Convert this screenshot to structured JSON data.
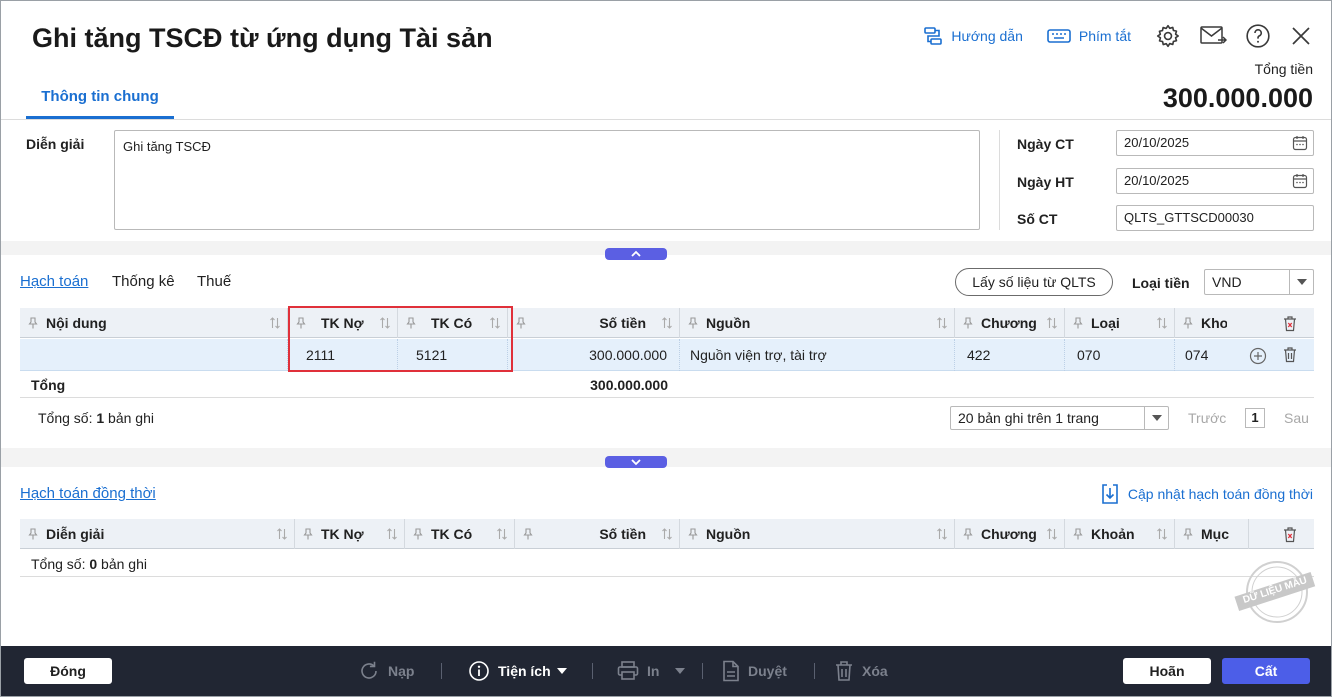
{
  "header": {
    "title": "Ghi tăng TSCĐ từ ứng dụng Tài sản",
    "guide_label": "Hướng dẫn",
    "shortcut_label": "Phím tắt",
    "total_label": "Tổng tiền",
    "total_value": "300.000.000",
    "tab_general": "Thông tin chung"
  },
  "form": {
    "desc_label": "Diễn giải",
    "desc_value": "Ghi tăng TSCĐ",
    "date_ct_label": "Ngày CT",
    "date_ct_value": "20/10/2025",
    "date_ht_label": "Ngày HT",
    "date_ht_value": "20/10/2025",
    "so_ct_label": "Số CT",
    "so_ct_value": "QLTS_GTTSCD00030"
  },
  "accounting": {
    "tabs": [
      "Hạch toán",
      "Thống kê",
      "Thuế"
    ],
    "fetch_button": "Lấy số liệu từ QLTS",
    "currency_label": "Loại tiền",
    "currency_value": "VND",
    "columns": [
      "Nội dung",
      "TK Nợ",
      "TK Có",
      "Số tiền",
      "Nguồn",
      "Chương",
      "Loại",
      "Kho"
    ],
    "row": {
      "noi_dung": "",
      "tk_no": "2111",
      "tk_co": "5121",
      "so_tien": "300.000.000",
      "nguon": "Nguồn viện trợ, tài trợ",
      "chuong": "422",
      "loai": "070",
      "kho": "074"
    },
    "sum_label": "Tổng",
    "sum_value": "300.000.000",
    "count_prefix": "Tổng số: ",
    "count_value": "1",
    "count_suffix": " bản ghi",
    "page_size": "20 bản ghi trên 1 trang",
    "prev": "Trước",
    "page": "1",
    "next": "Sau"
  },
  "concurrent": {
    "title": "Hạch toán đồng thời",
    "update_link": "Cập nhật hạch toán đồng thời",
    "columns": [
      "Diễn giải",
      "TK Nợ",
      "TK Có",
      "Số tiền",
      "Nguồn",
      "Chương",
      "Khoản",
      "Mục"
    ],
    "count_prefix": "Tổng số: ",
    "count_value": "0",
    "count_suffix": " bản ghi"
  },
  "stamp": "DỮ LIỆU MẪU",
  "bottom": {
    "close": "Đóng",
    "reload": "Nạp",
    "utilities": "Tiện ích",
    "print": "In",
    "approve": "Duyệt",
    "delete": "Xóa",
    "cancel": "Hoãn",
    "save": "Cất"
  },
  "colors": {
    "accent": "#1a6fd1",
    "primary_button": "#4c5ee8",
    "highlight": "#e0303a",
    "bottom_bar": "#212633"
  }
}
